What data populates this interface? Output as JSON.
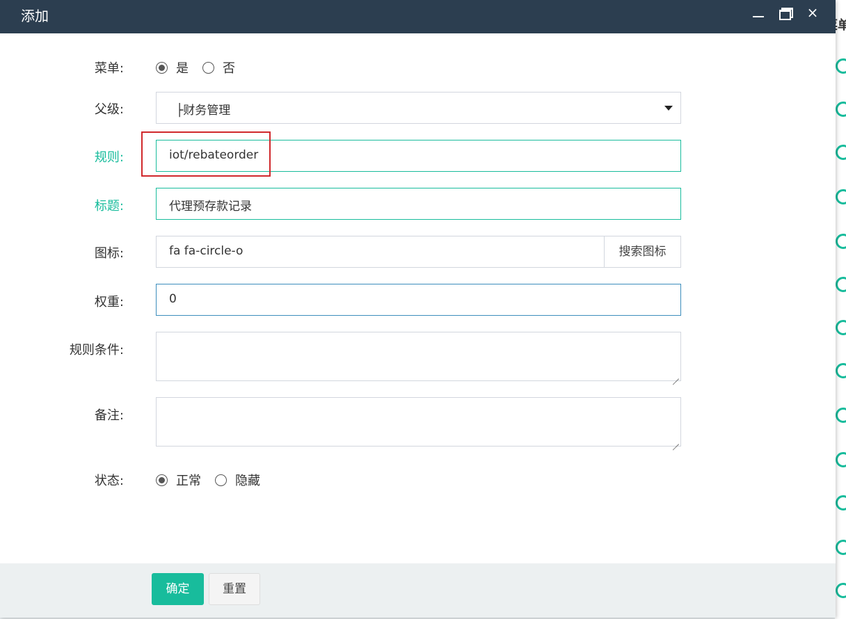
{
  "background": {
    "label": "菜单"
  },
  "dialog": {
    "title": "添加",
    "controls": {
      "minimize": "minimize-icon",
      "maximize": "maximize-icon",
      "close": "×"
    }
  },
  "form": {
    "menu": {
      "label": "菜单:",
      "options": [
        "是",
        "否"
      ],
      "selected": "是"
    },
    "parent": {
      "label": "父级:",
      "prefix": "├",
      "value": "财务管理"
    },
    "rule": {
      "label": "规则:",
      "value": "iot/rebateorder"
    },
    "title": {
      "label": "标题:",
      "value": "代理预存款记录"
    },
    "icon": {
      "label": "图标:",
      "value": "fa fa-circle-o",
      "button": "搜索图标"
    },
    "weight": {
      "label": "权重:",
      "value": "0"
    },
    "condition": {
      "label": "规则条件:",
      "value": ""
    },
    "remark": {
      "label": "备注:",
      "value": ""
    },
    "status": {
      "label": "状态:",
      "options": [
        "正常",
        "隐藏"
      ],
      "selected": "正常"
    }
  },
  "footer": {
    "confirm": "确定",
    "reset": "重置"
  },
  "colors": {
    "titlebar": "#2c3e50",
    "accent": "#18bc9c",
    "highlight": "#d0282c"
  }
}
